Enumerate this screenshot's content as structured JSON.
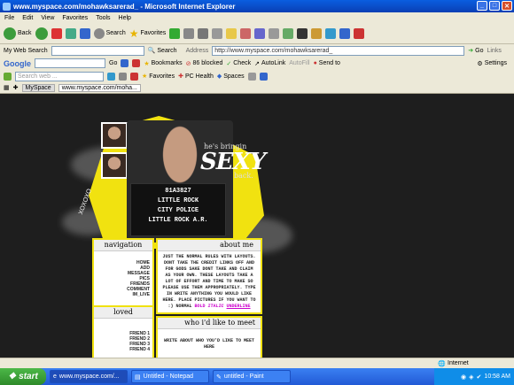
{
  "window": {
    "title": "www.myspace.com/mohawksarerad_ - Microsoft Internet Explorer"
  },
  "menu": [
    "File",
    "Edit",
    "View",
    "Favorites",
    "Tools",
    "Help"
  ],
  "toolbar": {
    "back": "Back",
    "search": "Search",
    "favorites": "Favorites"
  },
  "row1": {
    "my_web_search": "My Web Search",
    "search_btn": "Search",
    "address_label": "Address",
    "address_value": "http://www.myspace.com/mohawksarerad_",
    "go": "Go",
    "links": "Links"
  },
  "row2": {
    "google": "Google",
    "go": "Go",
    "bookmarks": "Bookmarks",
    "blocked": "86 blocked",
    "check": "Check",
    "autolink": "AutoLink",
    "autofill": "AutoFill",
    "sendto": "Send to",
    "settings": "Settings"
  },
  "row3": {
    "search_placeholder": "Search web ...",
    "favorites": "Favorites",
    "pc_health": "PC Health",
    "spaces": "Spaces"
  },
  "tabs": {
    "myspace": "MySpace",
    "current": "www.myspace.com/moha..."
  },
  "profile": {
    "sign_lines": [
      "81A3827",
      "LITTLE ROCK",
      "CITY POLICE",
      "LITTLE ROCK A.R."
    ],
    "tagline": "he's bringin",
    "sexy": "SEXY",
    "back": "back.",
    "vertical": "XOXOXO",
    "nav_title": "navigation",
    "nav_items": [
      "HOME",
      "ADD",
      "MESSAGE",
      "PICS",
      "FRIENDS",
      "COMMENT",
      "IM_LIVE"
    ],
    "loved_title": "loved",
    "loved_items": [
      "FRIEND 1",
      "FRIEND 2",
      "FRIEND 3",
      "FRIEND 4"
    ],
    "about_title": "about me",
    "about_text": "JUST THE NORMAL RULES WITH LAYOUTS. DONT TAKE THE CREDIT LINKS OFF AND FOR GODS SAKE DONT TAKE AND CLAIM AS YOUR OWN. THESE LAYOUTS TAKE A LOT OF EFFORT AND TIME TO MAKE SO PLEASE USE THEM APPROPRIATELY. TYPE IN WRITE ANYTHING YOU WOULD LIKE HERE. PLACE PICTURES IF YOU WANT TO :) NORMAL",
    "about_bold": "BOLD",
    "about_italic": "ITALIC",
    "about_underline": "UNDERLINE",
    "meet_title": "who i'd like to meet",
    "meet_text": "WRITE ABOUT WHO YOU'D LIKE TO MEET HERE"
  },
  "status": {
    "zone": "Internet"
  },
  "taskbar": {
    "start": "start",
    "tasks": [
      "www.myspace.com/...",
      "Untitled - Notepad",
      "untitled - Paint"
    ],
    "clock": "10:58 AM"
  }
}
